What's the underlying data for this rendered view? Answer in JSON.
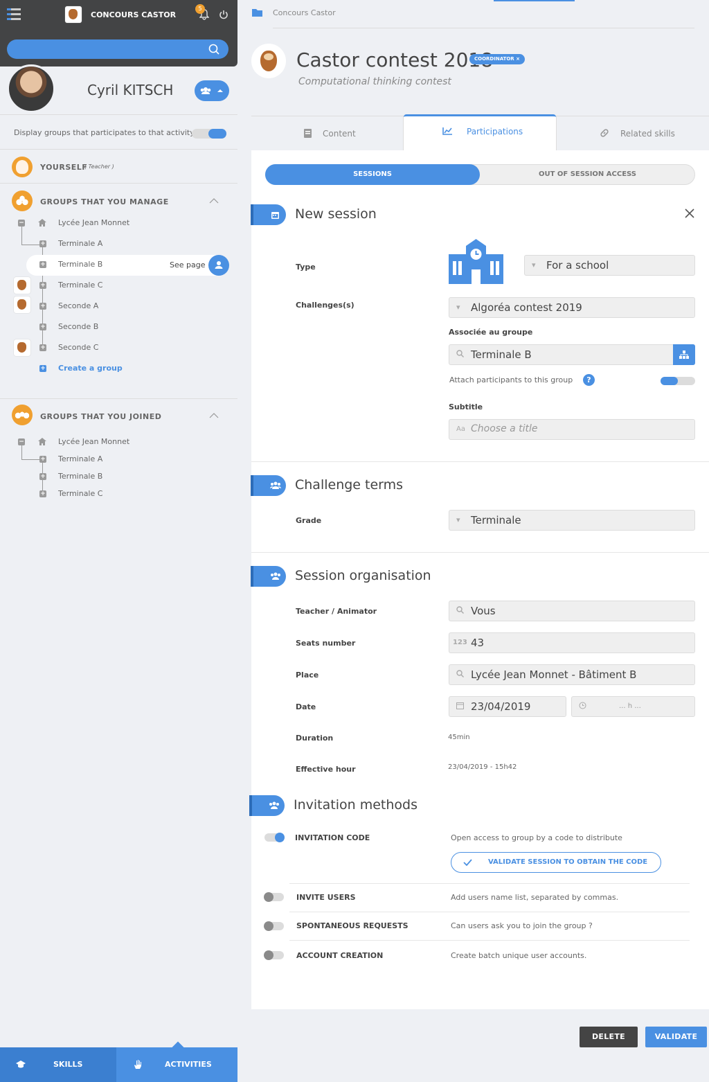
{
  "app": {
    "title": "CONCOURS CASTOR",
    "notif_count": "5"
  },
  "profile": {
    "name": "Cyril KITSCH"
  },
  "sidebar": {
    "display_groups_label": "Display groups that participates to that activity",
    "yourself_label": "YOURSELF",
    "yourself_role": "( Teacher )",
    "manage_title": "GROUPS THAT YOU MANAGE",
    "manage_root": "Lycée Jean Monnet",
    "manage_items": [
      "Terminale A",
      "Terminale B",
      "Terminale C",
      "Seconde A",
      "Seconde B",
      "Seconde C"
    ],
    "see_page": "See page",
    "create_group": "Create a group",
    "joined_title": "GROUPS THAT YOU JOINED",
    "joined_root": "Lycée Jean Monnet",
    "joined_items": [
      "Terminale A",
      "Terminale B",
      "Terminale C"
    ]
  },
  "bottom_nav": {
    "skills": "SKILLS",
    "activities": "ACTIVITIES"
  },
  "breadcrumb": "Concours Castor",
  "activity": {
    "title": "Castor contest 2018",
    "badge": "COORDINATOR ×",
    "subtitle": "Computational thinking contest"
  },
  "tabs": {
    "content": "Content",
    "participations": "Participations",
    "related": "Related skills"
  },
  "subtabs": {
    "sessions": "SESSIONS",
    "out_of_session": "OUT OF SESSION ACCESS"
  },
  "new_session": {
    "title": "New session",
    "type_label": "Type",
    "type_value": "For a school",
    "challenges_label": "Challenges(s)",
    "challenge_value": "Algoréa contest 2019",
    "group_label": "Associée au groupe",
    "group_value": "Terminale B",
    "attach_label": "Attach participants to this group",
    "subtitle_label": "Subtitle",
    "subtitle_placeholder": "Choose a title",
    "aa": "Aa"
  },
  "challenge_terms": {
    "title": "Challenge terms",
    "grade_label": "Grade",
    "grade_value": "Terminale"
  },
  "organisation": {
    "title": "Session organisation",
    "teacher_label": "Teacher / Animator",
    "teacher_value": "Vous",
    "seats_label": "Seats number",
    "seats_prefix": "123",
    "seats_value": "43",
    "place_label": "Place",
    "place_value": "Lycée Jean Monnet - Bâtiment B",
    "date_label": "Date",
    "date_value": "23/04/2019",
    "time_placeholder": "... h ...",
    "duration_label": "Duration",
    "duration_value": "45min",
    "effective_label": "Effective hour",
    "effective_value": "23/04/2019 - 15h42"
  },
  "invitation": {
    "title": "Invitation methods",
    "code_label": "INVITATION CODE",
    "code_desc": "Open access to group by a code to distribute",
    "code_button": "VALIDATE SESSION TO OBTAIN THE CODE",
    "invite_label": "INVITE USERS",
    "invite_desc": "Add users name list, separated by commas.",
    "spont_label": "SPONTANEOUS REQUESTS",
    "spont_desc": "Can users ask you to join the group ?",
    "account_label": "ACCOUNT CREATION",
    "account_desc": "Create batch unique user accounts."
  },
  "footer": {
    "delete": "DELETE",
    "validate": "VALIDATE"
  },
  "colors": {
    "accent": "#4a90e2",
    "dark": "#434445",
    "orange": "#f0a030"
  }
}
